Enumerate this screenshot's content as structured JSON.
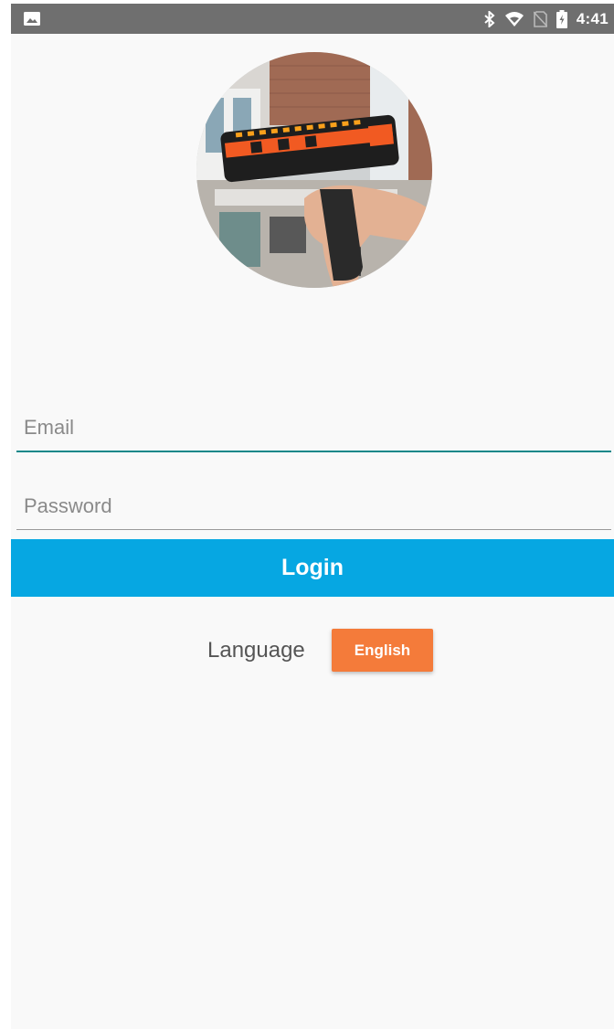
{
  "status_bar": {
    "time": "4:41",
    "icons": [
      "image-notification-icon",
      "bluetooth-icon",
      "wifi-icon",
      "no-sim-icon",
      "battery-icon"
    ]
  },
  "logo": {
    "icon": "barcode-scanner-photo"
  },
  "form": {
    "email_placeholder": "Email",
    "password_placeholder": "Password",
    "login_label": "Login"
  },
  "language": {
    "label": "Language",
    "selected": "English"
  },
  "colors": {
    "status_bar": "#6f6f6f",
    "background": "#f9f9f9",
    "login_button": "#06a7e2",
    "language_button": "#f47b3a",
    "focused_underline": "#12888a"
  }
}
